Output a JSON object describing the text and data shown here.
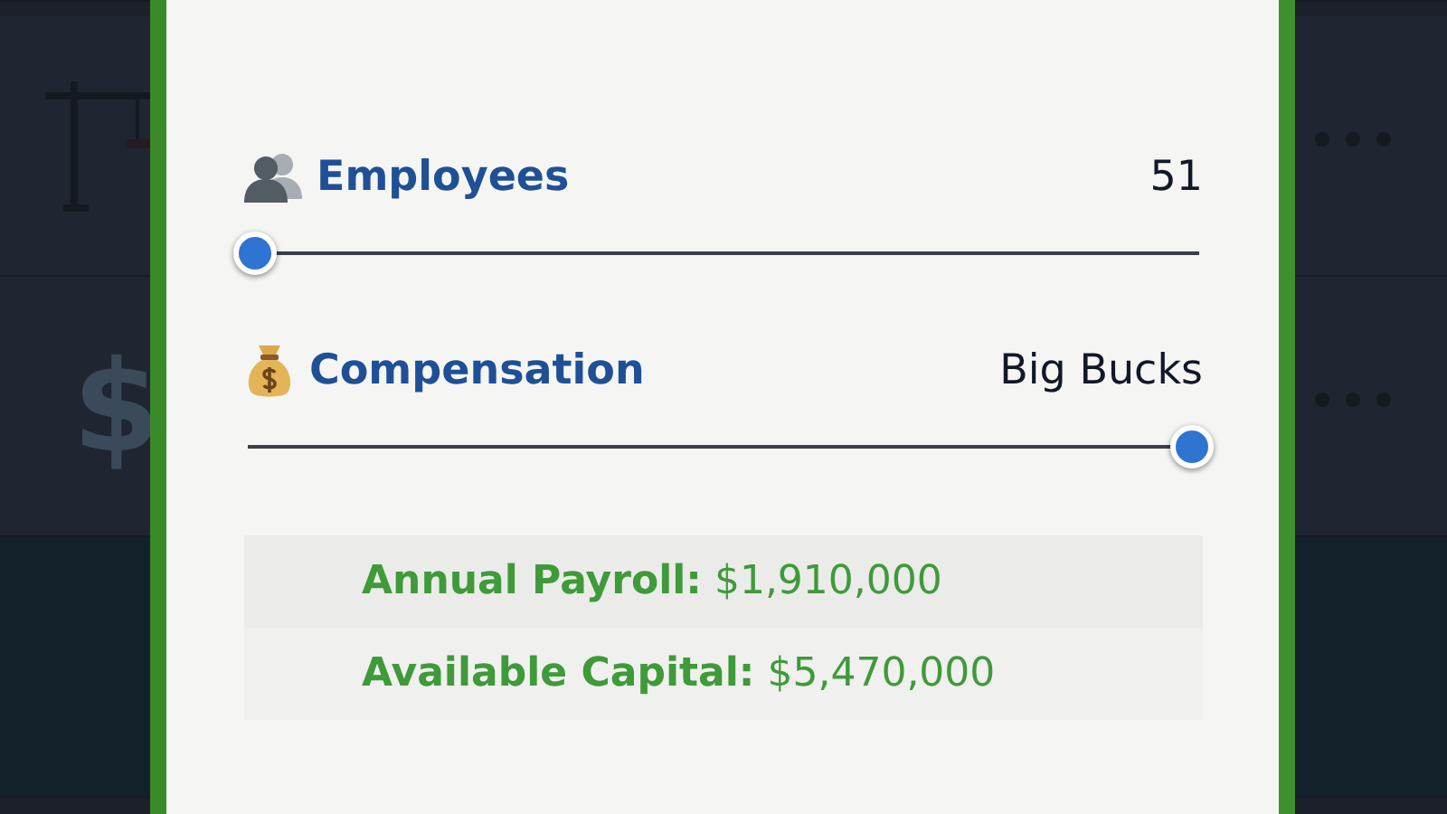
{
  "background_rows": [
    {
      "kind": "crane",
      "menu": true
    },
    {
      "kind": "money",
      "glyph": "$",
      "menu": true
    },
    {
      "kind": "plain",
      "menu": false
    }
  ],
  "settings": [
    {
      "kind": "people",
      "label": "Employees",
      "value": "51",
      "level": 0
    },
    {
      "kind": "money-bag",
      "label": "Compensation",
      "value": "Big Bucks",
      "level": 1
    }
  ],
  "summary": [
    {
      "text": "**Annual Payroll:** $1,910,000"
    },
    {
      "text": "**Available Capital:** $5,470,000"
    }
  ]
}
